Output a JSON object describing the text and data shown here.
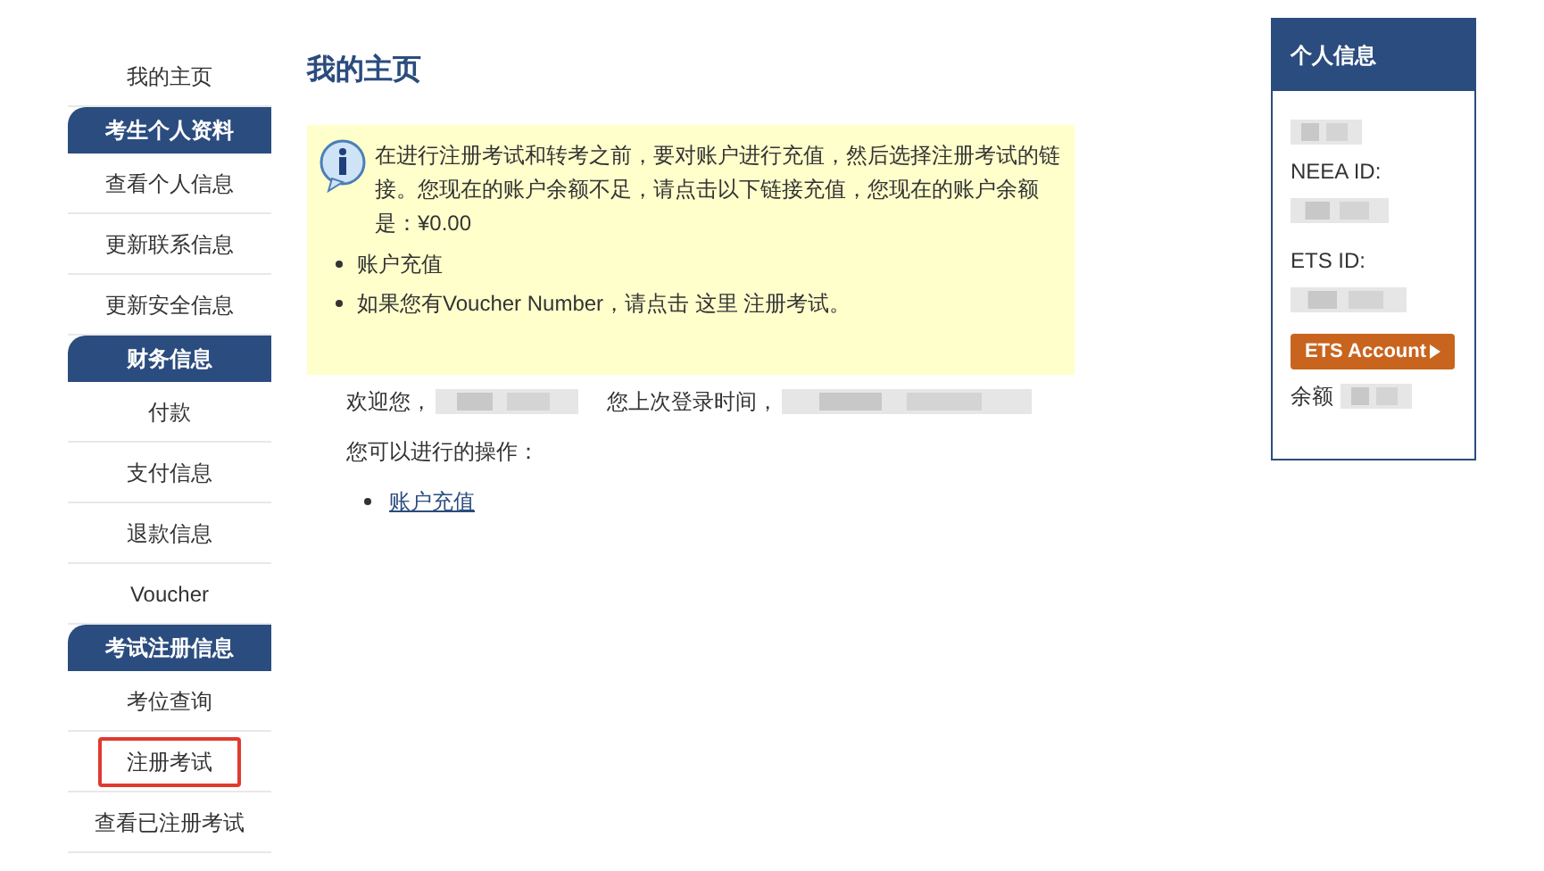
{
  "sidebar": {
    "items": [
      {
        "kind": "link",
        "label": "我的主页",
        "highlighted": false
      },
      {
        "kind": "header",
        "label": "考生个人资料"
      },
      {
        "kind": "link",
        "label": "查看个人信息",
        "highlighted": false
      },
      {
        "kind": "link",
        "label": "更新联系信息",
        "highlighted": false
      },
      {
        "kind": "link",
        "label": "更新安全信息",
        "highlighted": false
      },
      {
        "kind": "header",
        "label": "财务信息"
      },
      {
        "kind": "link",
        "label": "付款",
        "highlighted": false
      },
      {
        "kind": "link",
        "label": "支付信息",
        "highlighted": false
      },
      {
        "kind": "link",
        "label": "退款信息",
        "highlighted": false
      },
      {
        "kind": "link",
        "label": "Voucher",
        "highlighted": false
      },
      {
        "kind": "header",
        "label": "考试注册信息"
      },
      {
        "kind": "link",
        "label": "考位查询",
        "highlighted": false
      },
      {
        "kind": "link",
        "label": "注册考试",
        "highlighted": true
      },
      {
        "kind": "link",
        "label": "查看已注册考试",
        "highlighted": false
      }
    ]
  },
  "main": {
    "title": "我的主页",
    "notice": {
      "text": "在进行注册考试和转考之前，要对账户进行充值，然后选择注册考试的链接。您现在的账户余额不足，请点击以下链接充值，您现在的账户余额是：¥0.00",
      "bullets": [
        "账户充值",
        "如果您有Voucher Number，请点击 这里 注册考试。"
      ]
    },
    "welcome": "欢迎您，",
    "last_login": "您上次登录时间，",
    "actions_label": "您可以进行的操作：",
    "actions": [
      "账户充值"
    ]
  },
  "profile": {
    "title": "个人信息",
    "neea_label": "NEEA ID:",
    "ets_label": "ETS ID:",
    "ets_button": "ETS Account",
    "balance_label": "余额"
  }
}
